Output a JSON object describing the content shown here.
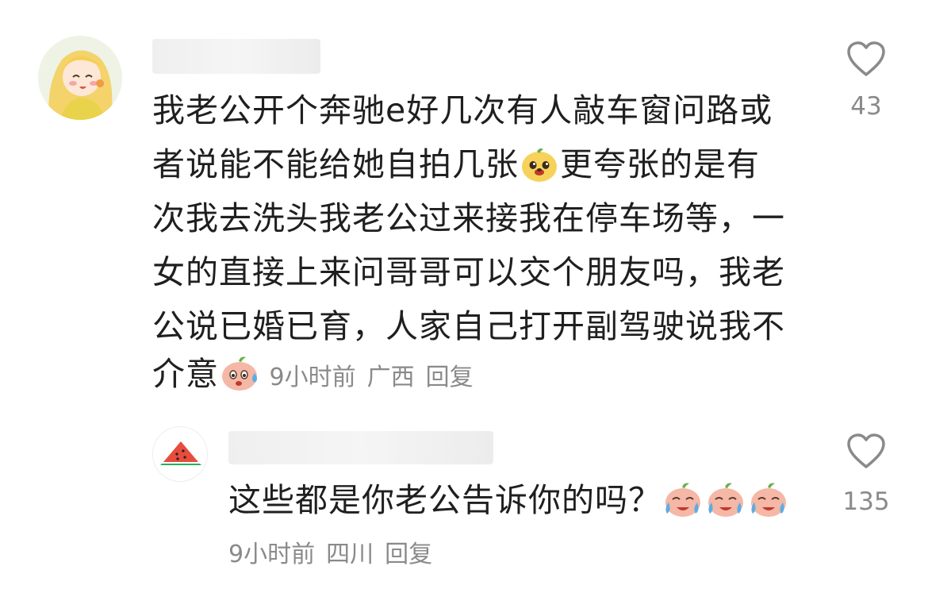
{
  "comments": [
    {
      "avatar_icon": "cartoon-girl-avatar",
      "lines": [
        "我老公开个奔驰e好几次有人敲车窗问路或",
        "者说能不能给她自拍几张",
        "更夸张的是有",
        "次我去洗头我老公过来接我在停车场等，一",
        "女的直接上来问哥哥可以交个朋友吗，我老",
        "公说已婚已育，人家自己打开副驾驶说我不",
        "介意"
      ],
      "time": "9小时前",
      "location": "广西",
      "reply_label": "回复",
      "likes": "43"
    },
    {
      "avatar_icon": "watermelon-avatar",
      "text": "这些都是你老公告诉你的吗？",
      "time": "9小时前",
      "location": "四川",
      "reply_label": "回复",
      "likes": "135"
    }
  ],
  "colors": {
    "text": "#1f1f1f",
    "meta": "#8a8a8a",
    "heart_outline": "#8a8a8a"
  }
}
